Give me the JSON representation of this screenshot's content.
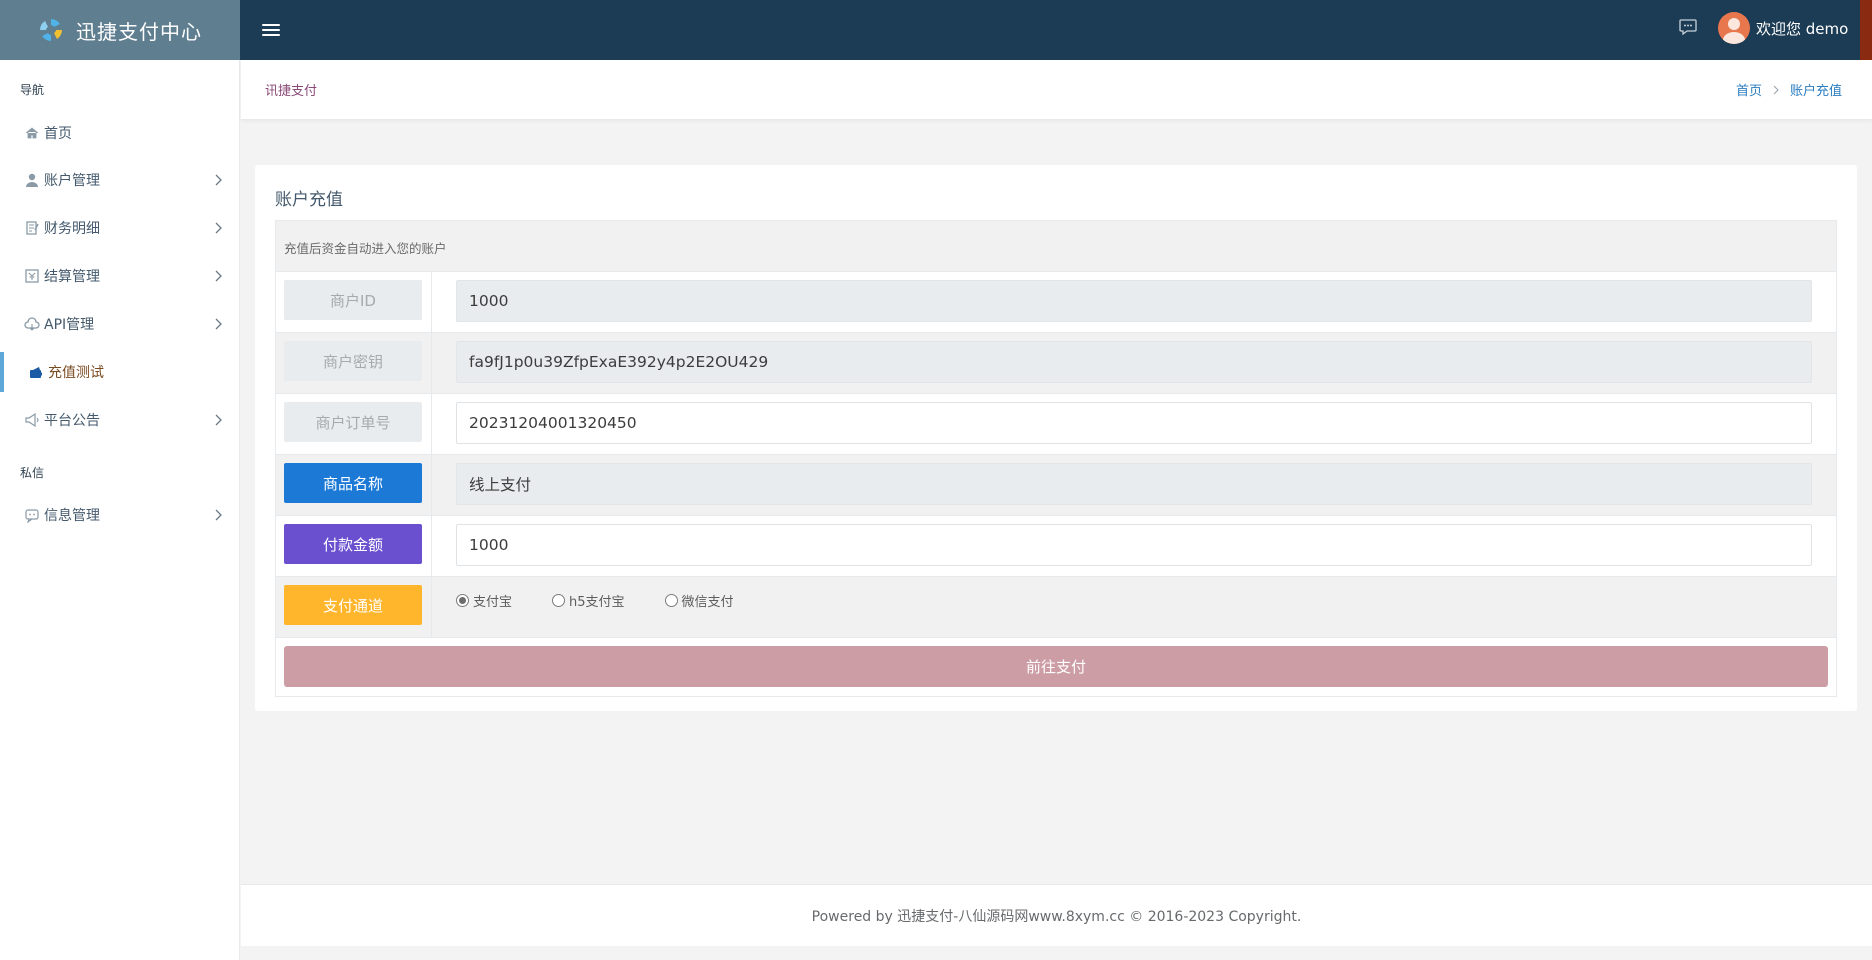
{
  "app": {
    "brand": "迅捷支付中心"
  },
  "topbar": {
    "user_label": "欢迎您 demo"
  },
  "sidebar": {
    "section_nav": "导航",
    "section_private": "私信",
    "items": [
      {
        "label": "首页",
        "icon": "home-icon"
      },
      {
        "label": "账户管理",
        "icon": "user-icon"
      },
      {
        "label": "财务明细",
        "icon": "ledger-icon"
      },
      {
        "label": "结算管理",
        "icon": "settlement-icon"
      },
      {
        "label": "API管理",
        "icon": "cloud-icon"
      },
      {
        "label": "充值测试",
        "icon": "wallet-icon",
        "active": true
      },
      {
        "label": "平台公告",
        "icon": "megaphone-icon"
      },
      {
        "label": "信息管理",
        "icon": "chat-icon"
      }
    ]
  },
  "header": {
    "title": "讯捷支付",
    "breadcrumb": [
      "首页",
      "账户充值"
    ]
  },
  "panel": {
    "title": "账户充值",
    "note": "充值后资金自动进入您的账户",
    "merchant_id": {
      "label": "商户ID",
      "value": "1000"
    },
    "merchant_key": {
      "label": "商户密钥",
      "value": "fa9fJ1p0u39ZfpExaE392y4p2E2OU429"
    },
    "order_no": {
      "label": "商户订单号",
      "value": "20231204001320450"
    },
    "product_name": {
      "label": "商品名称",
      "value": "线上支付"
    },
    "amount": {
      "label": "付款金额",
      "value": "1000"
    },
    "channel": {
      "label": "支付通道",
      "options": [
        "支付宝",
        "h5支付宝",
        "微信支付"
      ],
      "selected": "支付宝"
    },
    "submit_label": "前往支付"
  },
  "footer": {
    "text": "Powered by 迅捷支付-八仙源码网www.8xym.cc © 2016-2023 Copyright."
  },
  "colors": {
    "topbar": "#1c3b54",
    "brand_bg": "#5f7e90",
    "blue_label": "#1c7ad6",
    "purple_label": "#6a4fcf",
    "yellow_label": "#ffb62d",
    "pay_button": "#cd9da5",
    "active_border": "#5ea8d8"
  }
}
